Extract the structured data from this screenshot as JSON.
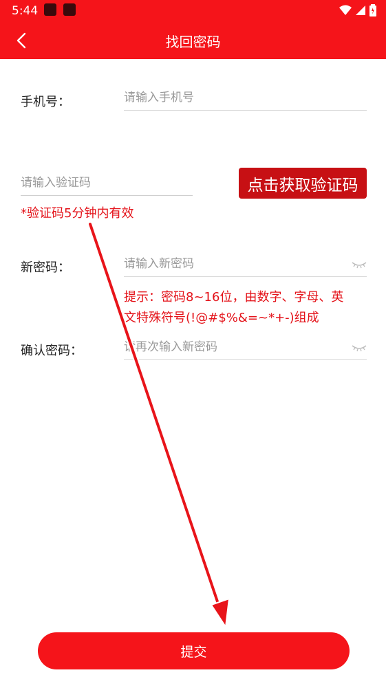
{
  "status_bar": {
    "time": "5:44"
  },
  "app_bar": {
    "title": "找回密码"
  },
  "form": {
    "phone": {
      "label": "手机号：",
      "placeholder": "请输入手机号"
    },
    "code": {
      "placeholder": "请输入验证码",
      "button_label": "点击获取验证码",
      "validity_note": "*验证码5分钟内有效"
    },
    "new_password": {
      "label": "新密码：",
      "placeholder": "请输入新密码",
      "hint_line1": "提示：密码8~16位，由数字、字母、英",
      "hint_line2": "文特殊符号(!@#$%&=~*+-)组成"
    },
    "confirm_password": {
      "label": "确认密码：",
      "placeholder": "请再次输入新密码"
    },
    "submit_label": "提交"
  },
  "colors": {
    "brand_red": "#f5141a",
    "button_dark_red": "#c71014",
    "hint_red": "#e4131a"
  },
  "icons": [
    "back-arrow-icon",
    "eye-closed-icon",
    "wifi-icon",
    "signal-icon",
    "battery-icon"
  ]
}
